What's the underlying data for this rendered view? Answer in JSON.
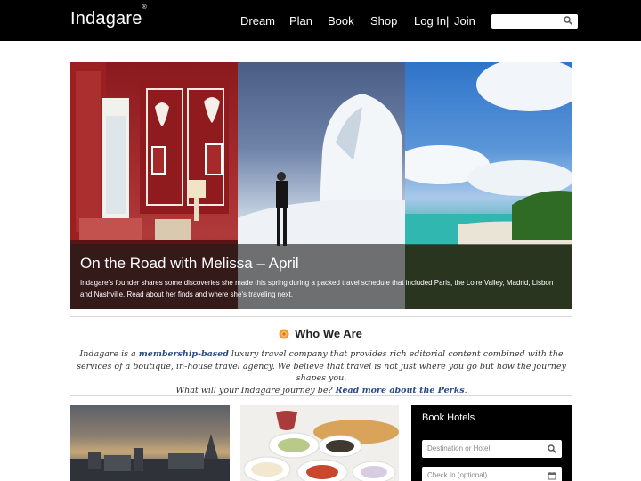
{
  "brand": {
    "name": "Indagare",
    "mark": "®"
  },
  "nav": {
    "items": [
      "Dream",
      "Plan",
      "Book",
      "Shop"
    ],
    "login": "Log In",
    "separator": "|",
    "join": "Join"
  },
  "search": {
    "placeholder": "",
    "icon": "search-icon"
  },
  "hero": {
    "title": "On the Road with Melissa – April",
    "text": "Indagare's founder shares some discoveries she made this spring during a packed travel schedule that included Paris, the Loire Valley, Madrid, Lisbon and Nashville. Read about her finds and where she's traveling next."
  },
  "who": {
    "title": "Who We Are",
    "icon": "flower-icon",
    "line1_pre": "Indagare is a ",
    "line1_link": "membership-based",
    "line1_post": " luxury travel company that provides rich editorial content combined with the services of a boutique, in-house travel agency. We believe that travel is not just where you go but how the journey shapes you.",
    "line2_pre": "What will your Indagare journey be? ",
    "line2_link": "Read more about the Perks",
    "line2_post": "."
  },
  "book": {
    "title": "Book Hotels",
    "destination_placeholder": "Destination or Hotel",
    "checkin_placeholder": "Check In (optional)"
  },
  "colors": {
    "header": "#000000",
    "link": "#2a4a86",
    "accent": "#f0a020"
  }
}
